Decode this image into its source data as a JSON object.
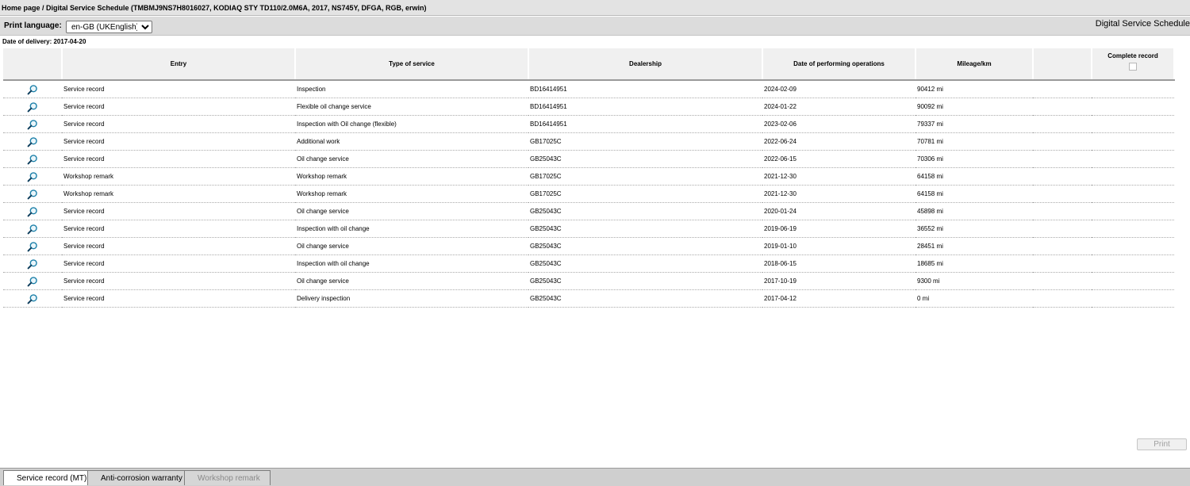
{
  "breadcrumb": "Home page / Digital Service Schedule (TMBMJ9NS7H8016027, KODIAQ STY TD110/2.0M6A, 2017, NS745Y, DFGA, RGB, erwin)",
  "print_language": {
    "label": "Print language:",
    "selected": "en-GB (UKEnglish)"
  },
  "app_title": "Digital Service Schedule",
  "delivery_date": "Date of delivery: 2017-04-20",
  "table": {
    "headers": {
      "entry": "Entry",
      "type": "Type of service",
      "dealership": "Dealership",
      "date": "Date of performing operations",
      "mileage": "Mileage/km",
      "complete": "Complete record"
    },
    "rows": [
      {
        "entry": "Service record",
        "type": "Inspection",
        "dealership": "BD16414951",
        "date": "2024-02-09",
        "mileage": "90412 mi"
      },
      {
        "entry": "Service record",
        "type": "Flexible oil change service",
        "dealership": "BD16414951",
        "date": "2024-01-22",
        "mileage": "90092 mi"
      },
      {
        "entry": "Service record",
        "type": "Inspection with Oil change (flexible)",
        "dealership": "BD16414951",
        "date": "2023-02-06",
        "mileage": "79337 mi"
      },
      {
        "entry": "Service record",
        "type": "Additional work",
        "dealership": "GB17025C",
        "date": "2022-06-24",
        "mileage": "70781 mi"
      },
      {
        "entry": "Service record",
        "type": "Oil change service",
        "dealership": "GB25043C",
        "date": "2022-06-15",
        "mileage": "70306 mi"
      },
      {
        "entry": "Workshop remark",
        "type": "Workshop remark",
        "dealership": "GB17025C",
        "date": "2021-12-30",
        "mileage": "64158 mi"
      },
      {
        "entry": "Workshop remark",
        "type": "Workshop remark",
        "dealership": "GB17025C",
        "date": "2021-12-30",
        "mileage": "64158 mi"
      },
      {
        "entry": "Service record",
        "type": "Oil change service",
        "dealership": "GB25043C",
        "date": "2020-01-24",
        "mileage": "45898 mi"
      },
      {
        "entry": "Service record",
        "type": "Inspection with oil change",
        "dealership": "GB25043C",
        "date": "2019-06-19",
        "mileage": "36552 mi"
      },
      {
        "entry": "Service record",
        "type": "Oil change service",
        "dealership": "GB25043C",
        "date": "2019-01-10",
        "mileage": "28451 mi"
      },
      {
        "entry": "Service record",
        "type": "Inspection with oil change",
        "dealership": "GB25043C",
        "date": "2018-06-15",
        "mileage": "18685 mi"
      },
      {
        "entry": "Service record",
        "type": "Oil change service",
        "dealership": "GB25043C",
        "date": "2017-10-19",
        "mileage": "9300 mi"
      },
      {
        "entry": "Service record",
        "type": "Delivery inspection",
        "dealership": "GB25043C",
        "date": "2017-04-12",
        "mileage": "0 mi"
      }
    ]
  },
  "print_button": "Print",
  "tabs": [
    {
      "label": "Service record (MT)",
      "state": "active"
    },
    {
      "label": "Anti-corrosion warranty",
      "state": "normal"
    },
    {
      "label": "Workshop remark",
      "state": "disabled"
    }
  ],
  "icons": {
    "row_detail": "magnifier-icon"
  },
  "colors": {
    "magnifier": "#1a7fa8"
  }
}
